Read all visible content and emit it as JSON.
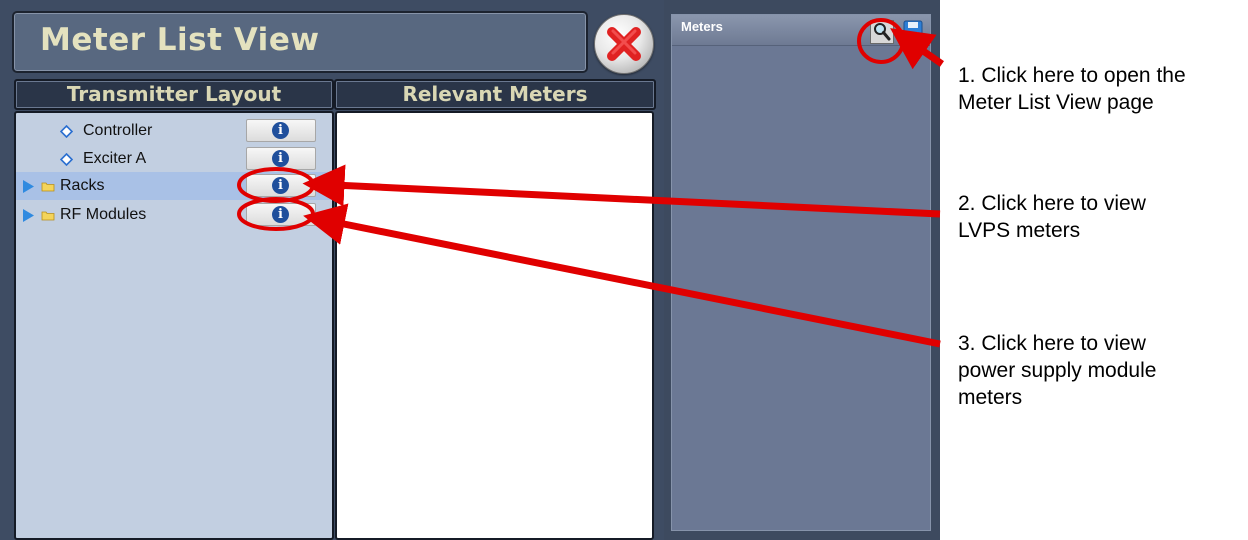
{
  "window": {
    "title": "Meter List View"
  },
  "columns": {
    "left_header": "Transmitter Layout",
    "right_header": "Relevant Meters"
  },
  "tree": {
    "items": [
      {
        "label": "Controller",
        "icon": "diamond-icon",
        "expandable": false,
        "selected": false
      },
      {
        "label": "Exciter A",
        "icon": "diamond-icon",
        "expandable": false,
        "selected": false
      },
      {
        "label": "Racks",
        "icon": "folder-icon",
        "expandable": true,
        "selected": true
      },
      {
        "label": "RF Modules",
        "icon": "folder-icon",
        "expandable": true,
        "selected": false
      }
    ]
  },
  "meters_panel": {
    "title": "Meters"
  },
  "callouts": [
    {
      "line1": "1. Click here to open the",
      "line2": "Meter List View page"
    },
    {
      "line1": "2. Click here to view",
      "line2": "LVPS meters"
    },
    {
      "line1": "3. Click here to view",
      "line2": "power supply module",
      "line3": "meters"
    }
  ],
  "colors": {
    "accent_red": "#e00000",
    "title_text": "#e4e2bf",
    "selected_row": "#a9c1e6",
    "tree_bg": "#c2cfe1",
    "info_blue": "#1f4f9c"
  }
}
